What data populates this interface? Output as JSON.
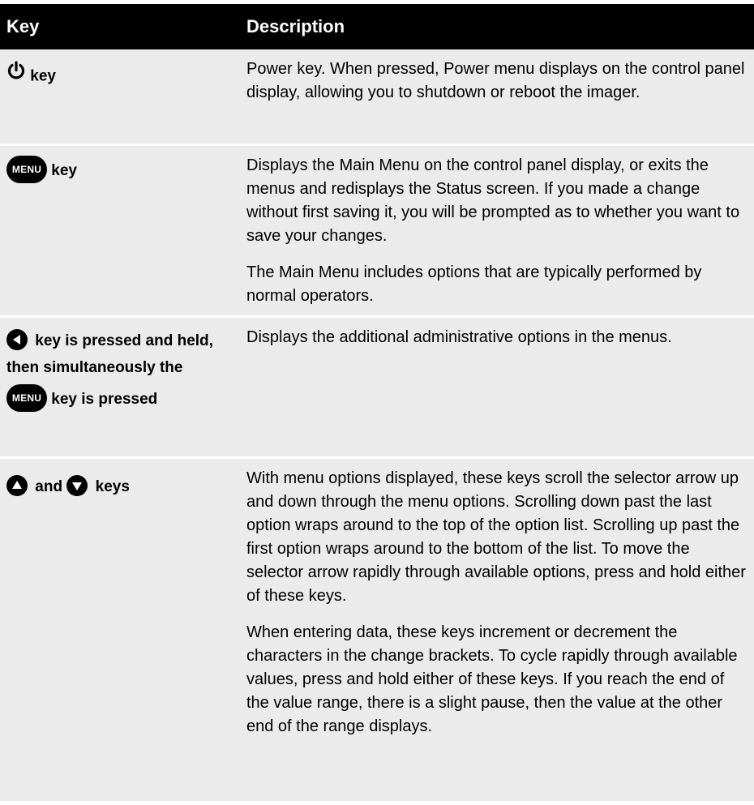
{
  "header": {
    "key_col": "Key",
    "desc_col": "Description"
  },
  "rows": [
    {
      "key_icon": "power-icon",
      "key_text": "key",
      "paragraphs": [
        "Power key. When pressed, Power menu displays on the control panel display, allowing you to shutdown or reboot the imager."
      ]
    },
    {
      "key_icon": "menu-button-icon",
      "menu_badge": "MENU",
      "key_text": "key",
      "paragraphs": [
        "Displays the Main Menu on the control panel display, or exits the menus and redisplays the Status screen. If you made a change without first saving it, you will be prompted as to whether you want to save your changes.",
        "The Main Menu includes options that are typically performed by normal operators."
      ]
    },
    {
      "key_icon": "left-arrow-icon",
      "key_text_part1": "key is pressed and held, then simultaneously the",
      "menu_badge": "MENU",
      "key_text_part2": "key is pressed",
      "paragraphs": [
        "Displays the additional administrative options in the menus."
      ]
    },
    {
      "key_icon": "up-arrow-icon",
      "key_icon_2": "down-arrow-icon",
      "key_text_and": "and",
      "key_text": "keys",
      "paragraphs": [
        "With menu options displayed, these keys scroll the selector arrow up and down through the menu options. Scrolling down past the last option wraps around to the top of the option list. Scrolling up past the first option wraps around to the bottom of the list. To move the selector arrow rapidly through available options, press and hold either of these keys.",
        "When entering data, these keys increment or decrement the characters in the change brackets. To cycle rapidly through available values, press and hold either of these keys. If you reach the end of the value range, there is a slight pause, then the value at the other end of the range displays."
      ]
    }
  ],
  "colors": {
    "header_bg": "#000000",
    "header_text": "#ffffff",
    "row_bg": "#ebebeb"
  }
}
